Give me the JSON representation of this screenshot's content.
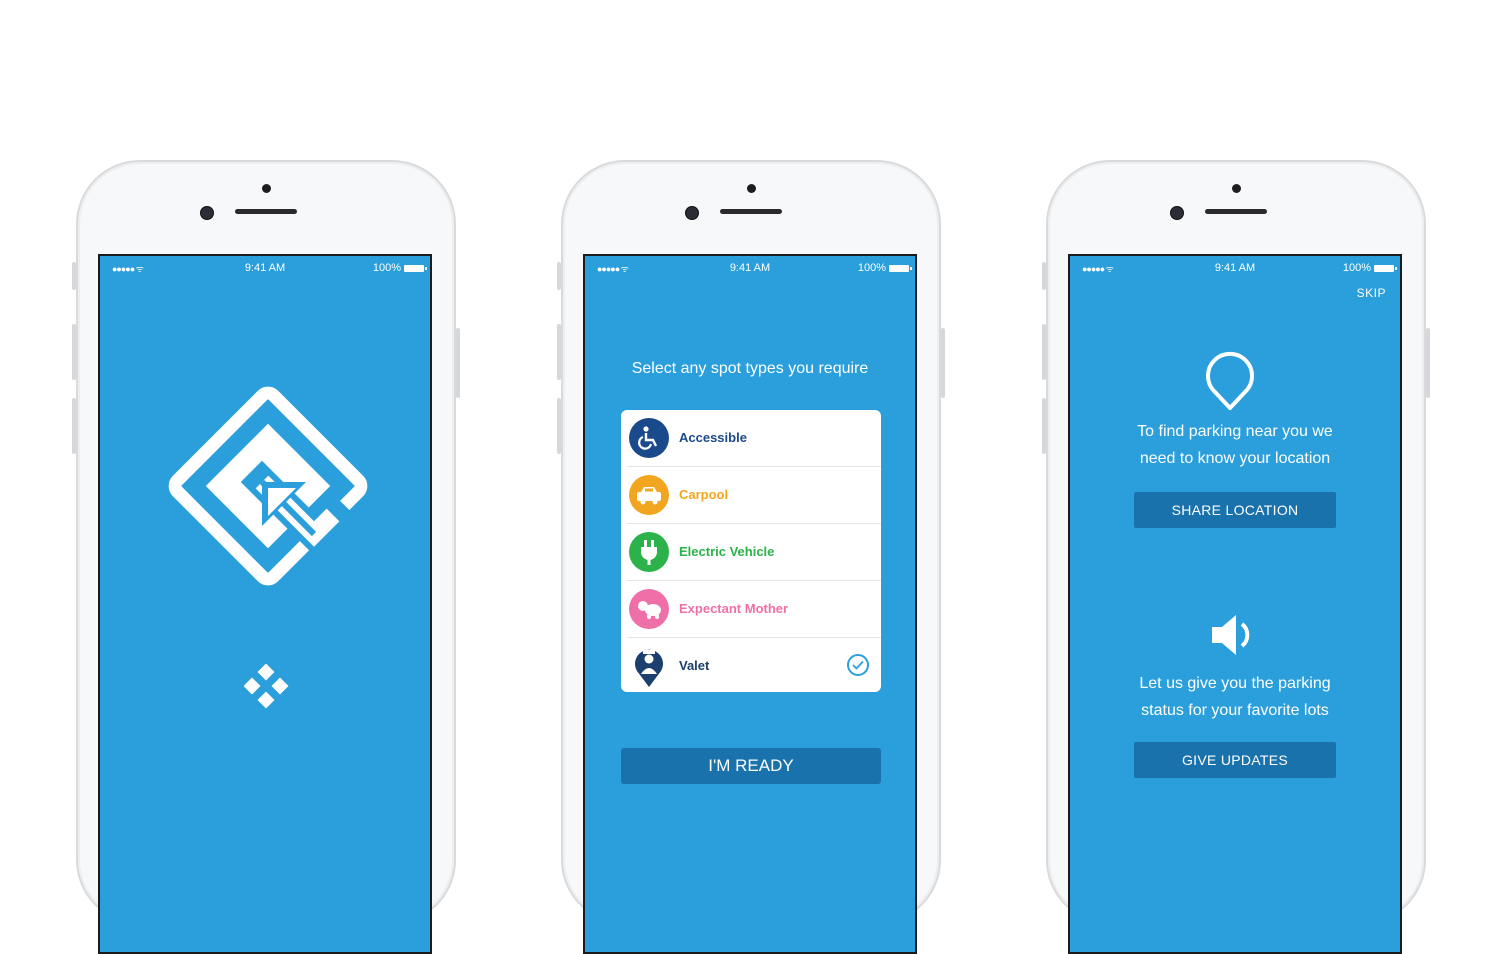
{
  "status_bar": {
    "signal": "●●●●● ᯤ",
    "time": "9:41 AM",
    "battery": "100%"
  },
  "splash": {
    "logo_icon": "diamond-arrow-logo",
    "loader_icon": "four-diamond-loader"
  },
  "spot_select": {
    "heading": "Select any spot types you require",
    "items": [
      {
        "label": "Accessible",
        "color": "#1b4a8c",
        "icon": "wheelchair-icon",
        "checked": false
      },
      {
        "label": "Carpool",
        "color": "#f2a51e",
        "icon": "car-icon",
        "checked": false
      },
      {
        "label": "Electric Vehicle",
        "color": "#2cb24a",
        "icon": "plug-icon",
        "checked": false
      },
      {
        "label": "Expectant Mother",
        "color": "#ef6fa8",
        "icon": "baby-icon",
        "checked": false
      },
      {
        "label": "Valet",
        "color": "#1b3f6e",
        "icon": "valet-icon",
        "checked": true
      }
    ],
    "ready_label": "I'M READY"
  },
  "permissions": {
    "skip_label": "SKIP",
    "location_text_1": "To find parking near you we",
    "location_text_2": "need to know your location",
    "share_label": "SHARE LOCATION",
    "updates_text_1": "Let us give you the parking",
    "updates_text_2": "status for your favorite lots",
    "updates_label": "GIVE UPDATES"
  },
  "colors": {
    "screen_bg": "#2a9fdc",
    "button_bg": "#1a72ad"
  }
}
